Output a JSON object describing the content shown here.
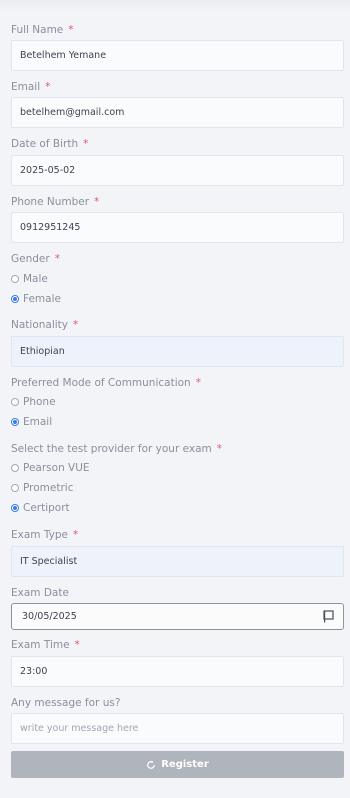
{
  "form": {
    "full_name": {
      "label": "Full Name",
      "required": "*",
      "value": "Betelhem Yemane"
    },
    "email": {
      "label": "Email",
      "required": "*",
      "value": "betelhem@gmail.com"
    },
    "dob": {
      "label": "Date of Birth",
      "required": "*",
      "value": "2025-05-02"
    },
    "phone": {
      "label": "Phone Number",
      "required": "*",
      "value": "0912951245"
    },
    "gender": {
      "label": "Gender",
      "required": "*",
      "options": [
        "Male",
        "Female"
      ],
      "selected": "Female"
    },
    "nationality": {
      "label": "Nationality",
      "required": "*",
      "value": "Ethiopian"
    },
    "communication": {
      "label": "Preferred Mode of Communication",
      "required": "*",
      "options": [
        "Phone",
        "Email"
      ],
      "selected": "Email"
    },
    "provider": {
      "label": "Select the test provider for your exam",
      "required": "*",
      "options": [
        "Pearson VUE",
        "Prometric",
        "Certiport"
      ],
      "selected": "Certiport"
    },
    "exam_type": {
      "label": "Exam Type",
      "required": "*",
      "value": "IT Specialist"
    },
    "exam_date": {
      "label": "Exam Date",
      "value": "30/05/2025"
    },
    "exam_time": {
      "label": "Exam Time",
      "required": "*",
      "value": "23:00"
    },
    "message": {
      "label": "Any message for us?",
      "placeholder": "write your message here"
    },
    "register_label": "Register"
  },
  "icons": {
    "calendar": "calendar-icon",
    "register": "refresh-icon"
  },
  "colors": {
    "accent": "#3b7be0",
    "required": "#e0586a",
    "button": "#b0b4bc"
  }
}
